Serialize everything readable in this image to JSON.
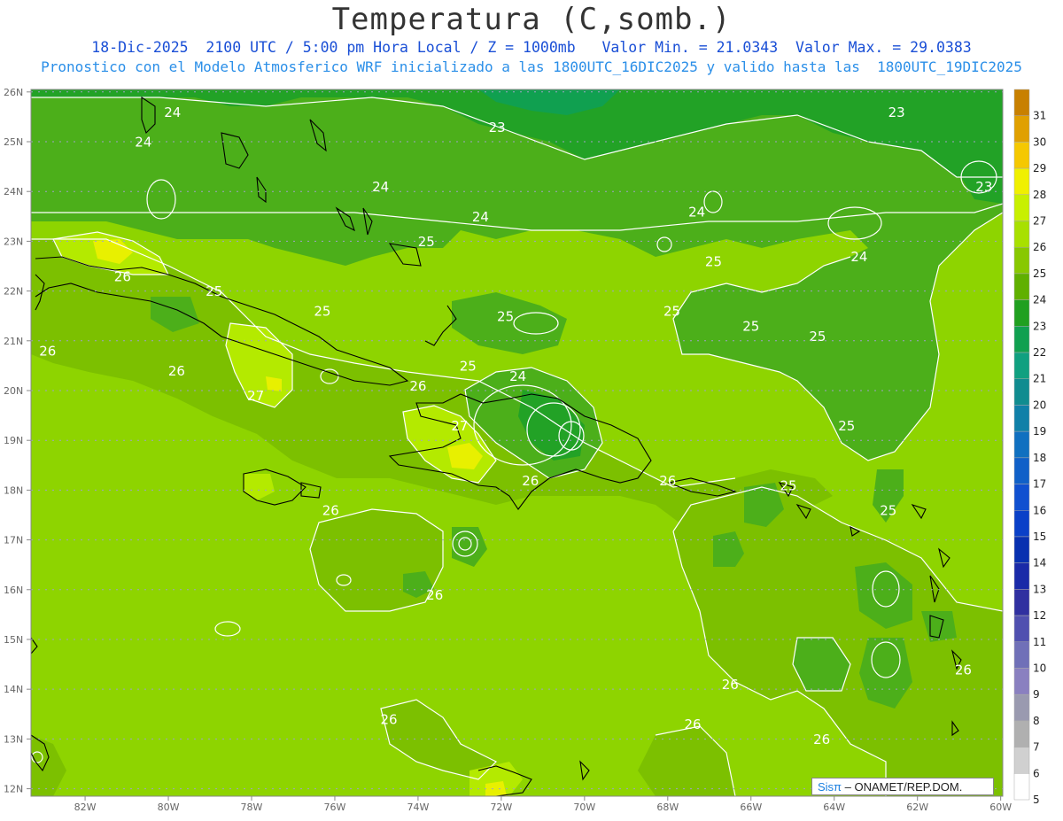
{
  "title": "Temperatura (C,somb.)",
  "subtitle_line1": "18-Dic-2025  2100 UTC / 5:00 pm Hora Local / Z = 1000mb   Valor Min. = 21.0343  Valor Max. = 29.0383",
  "subtitle_line2": "Pronostico con el Modelo Atmosferico WRF inicializado a las 1800UTC_16DIC2025 y valido hasta las  1800UTC_19DIC2025",
  "credit": {
    "logo": "Sisπ",
    "org": "– ONAMET/REP.DOM."
  },
  "lat_labels": [
    "26N",
    "25N",
    "24N",
    "23N",
    "22N",
    "21N",
    "20N",
    "19N",
    "18N",
    "17N",
    "16N",
    "15N",
    "14N",
    "13N",
    "12N"
  ],
  "lon_labels": [
    "82W",
    "80W",
    "78W",
    "76W",
    "74W",
    "72W",
    "70W",
    "68W",
    "66W",
    "64W",
    "62W",
    "60W"
  ],
  "colorbar": {
    "levels": [
      "31",
      "30",
      "29",
      "28",
      "27",
      "26",
      "25",
      "24",
      "23",
      "22",
      "21",
      "20",
      "19",
      "18",
      "17",
      "16",
      "15",
      "14",
      "13",
      "12",
      "11",
      "10",
      "9",
      "8",
      "7",
      "6",
      "5"
    ],
    "colors": [
      "#c88000",
      "#e0a000",
      "#f5c800",
      "#f0f000",
      "#c8f000",
      "#a8e000",
      "#88c800",
      "#60b000",
      "#20a020",
      "#10a050",
      "#10a080",
      "#108c90",
      "#1080a8",
      "#1070c0",
      "#1060c8",
      "#1050d0",
      "#0a40c8",
      "#0830b0",
      "#1a2aa8",
      "#3030a0",
      "#5050b0",
      "#7070b8",
      "#8a80c0",
      "#9a9ab0",
      "#b0b0b0",
      "#d0d0d0",
      "#ffffff"
    ]
  },
  "field": {
    "variable": "Temperatura",
    "unit": "C",
    "min": 21.0343,
    "max": 29.0383,
    "contour_labels": [
      {
        "value": "24",
        "lon": -79.9,
        "lat": 25.5
      },
      {
        "value": "24",
        "lon": -80.6,
        "lat": 24.9
      },
      {
        "value": "23",
        "lon": -72.1,
        "lat": 25.2
      },
      {
        "value": "23",
        "lon": -62.5,
        "lat": 25.5
      },
      {
        "value": "23",
        "lon": -60.4,
        "lat": 24.0
      },
      {
        "value": "24",
        "lon": -74.9,
        "lat": 24.0
      },
      {
        "value": "24",
        "lon": -72.5,
        "lat": 23.4
      },
      {
        "value": "24",
        "lon": -67.3,
        "lat": 23.5
      },
      {
        "value": "24",
        "lon": -63.4,
        "lat": 22.6
      },
      {
        "value": "25",
        "lon": -73.8,
        "lat": 22.9
      },
      {
        "value": "25",
        "lon": -66.9,
        "lat": 22.5
      },
      {
        "value": "26",
        "lon": -81.1,
        "lat": 22.2
      },
      {
        "value": "25",
        "lon": -78.9,
        "lat": 21.9
      },
      {
        "value": "25",
        "lon": -76.3,
        "lat": 21.5
      },
      {
        "value": "25",
        "lon": -71.9,
        "lat": 21.4
      },
      {
        "value": "25",
        "lon": -67.9,
        "lat": 21.5
      },
      {
        "value": "25",
        "lon": -66.0,
        "lat": 21.2
      },
      {
        "value": "25",
        "lon": -64.4,
        "lat": 21.0
      },
      {
        "value": "26",
        "lon": -82.9,
        "lat": 20.7
      },
      {
        "value": "26",
        "lon": -79.8,
        "lat": 20.3
      },
      {
        "value": "25",
        "lon": -72.8,
        "lat": 20.4
      },
      {
        "value": "24",
        "lon": -71.6,
        "lat": 20.2
      },
      {
        "value": "26",
        "lon": -74.0,
        "lat": 20.0
      },
      {
        "value": "27",
        "lon": -77.9,
        "lat": 19.8
      },
      {
        "value": "27",
        "lon": -73.0,
        "lat": 19.2
      },
      {
        "value": "25",
        "lon": -63.7,
        "lat": 19.2
      },
      {
        "value": "26",
        "lon": -71.3,
        "lat": 18.1
      },
      {
        "value": "26",
        "lon": -68.0,
        "lat": 18.1
      },
      {
        "value": "25",
        "lon": -65.1,
        "lat": 18.0
      },
      {
        "value": "26",
        "lon": -76.1,
        "lat": 17.5
      },
      {
        "value": "25",
        "lon": -62.7,
        "lat": 17.5
      },
      {
        "value": "26",
        "lon": -73.6,
        "lat": 15.8
      },
      {
        "value": "26",
        "lon": -60.9,
        "lat": 14.3
      },
      {
        "value": "26",
        "lon": -66.5,
        "lat": 14.0
      },
      {
        "value": "26",
        "lon": -74.7,
        "lat": 13.3
      },
      {
        "value": "26",
        "lon": -67.4,
        "lat": 13.2
      },
      {
        "value": "26",
        "lon": -64.3,
        "lat": 12.9
      }
    ]
  }
}
